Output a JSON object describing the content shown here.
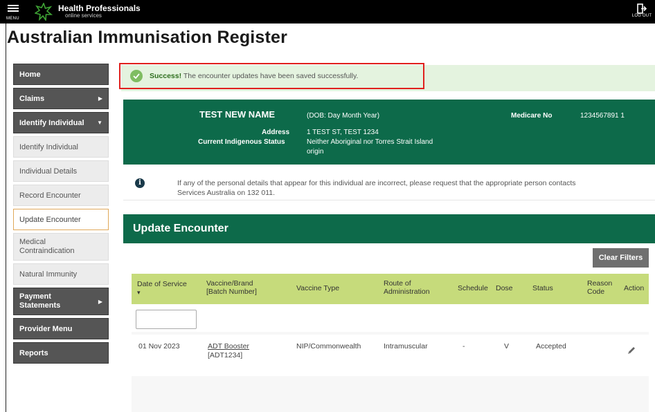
{
  "header": {
    "menu_label": "MENU",
    "brand_title": "Health Professionals",
    "brand_subtitle": "online services",
    "logout_label": "LOG OUT"
  },
  "page_title": "Australian Immunisation Register",
  "sidebar": {
    "items": [
      {
        "label": "Home"
      },
      {
        "label": "Claims"
      },
      {
        "label": "Identify Individual"
      },
      {
        "label": "Identify Individual"
      },
      {
        "label": "Individual Details"
      },
      {
        "label": "Record Encounter"
      },
      {
        "label": "Update Encounter"
      },
      {
        "label": "Medical Contraindication"
      },
      {
        "label": "Natural Immunity"
      },
      {
        "label": "Payment Statements"
      },
      {
        "label": "Provider Menu"
      },
      {
        "label": "Reports"
      }
    ]
  },
  "success": {
    "strong": "Success!",
    "message": " The encounter updates have been saved successfully."
  },
  "patient": {
    "name": "TEST NEW NAME",
    "dob": "(DOB: Day Month Year)",
    "medicare_label": "Medicare No",
    "medicare_value": "1234567891 1",
    "address_label": "Address",
    "address_value": "1 TEST ST, TEST 1234",
    "indigenous_label": "Current Indigenous Status",
    "indigenous_value_line1": "Neither Aboriginal nor Torres Strait Island",
    "indigenous_value_line2": "origin"
  },
  "info": {
    "line1": "If any of the personal details that appear for this individual are incorrect, please request that the appropriate person contacts",
    "line2": "Services Australia on 132 011."
  },
  "update_section": {
    "title": "Update Encounter",
    "clear_filters": "Clear Filters"
  },
  "table": {
    "headers": {
      "date_of_service": "Date of Service",
      "sort_indicator": "▾",
      "vaccine_brand_l1": "Vaccine/Brand",
      "vaccine_brand_l2": "[Batch Number]",
      "vaccine_type": "Vaccine Type",
      "route_l1": "Route of",
      "route_l2": "Administration",
      "schedule": "Schedule",
      "dose": "Dose",
      "status": "Status",
      "reason_l1": "Reason",
      "reason_l2": "Code",
      "action": "Action"
    },
    "filter_value": "",
    "rows": [
      {
        "date": "01 Nov 2023",
        "vaccine": "ADT Booster",
        "batch": "[ADT1234]",
        "vaccine_type": "NIP/Commonwealth",
        "route": "Intramuscular",
        "schedule": "-",
        "dose": "V",
        "status": "Accepted",
        "reason": "",
        "action_icon": "pencil-icon"
      }
    ]
  },
  "colors": {
    "brand_green": "#0d6a4a",
    "table_header": "#c6db7b",
    "success_bg": "#e4f3df",
    "highlight_red": "#e0201e",
    "nav_dark": "#555555"
  }
}
